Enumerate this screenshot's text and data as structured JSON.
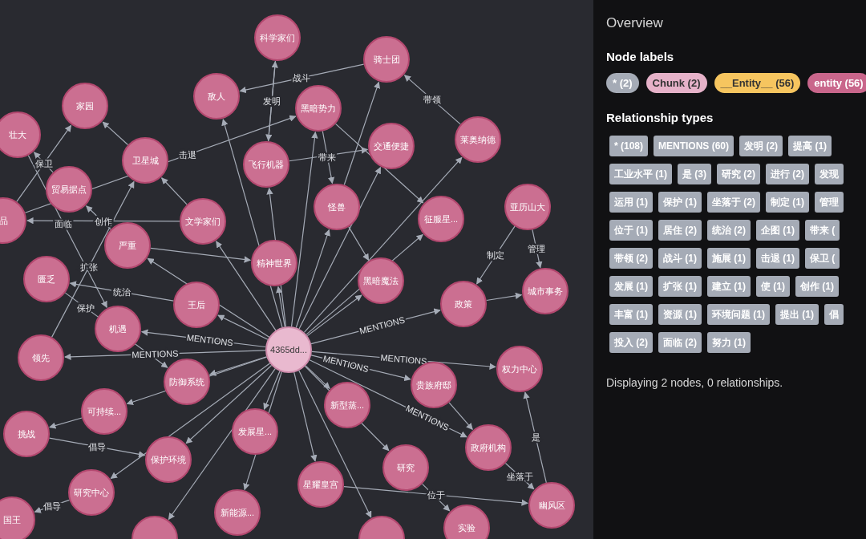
{
  "graph": {
    "nodes": [
      {
        "label": "科学家们",
        "kind": "entity"
      },
      {
        "label": "骑士团",
        "kind": "entity"
      },
      {
        "label": "敌人",
        "kind": "entity"
      },
      {
        "label": "黑暗势力",
        "kind": "entity"
      },
      {
        "label": "家园",
        "kind": "entity"
      },
      {
        "label": "壮大",
        "kind": "entity"
      },
      {
        "label": "卫星城",
        "kind": "entity"
      },
      {
        "label": "飞行机器",
        "kind": "entity"
      },
      {
        "label": "交通便捷",
        "kind": "entity"
      },
      {
        "label": "莱奥纳德",
        "kind": "entity"
      },
      {
        "label": "贸易据点",
        "kind": "entity"
      },
      {
        "label": "品",
        "kind": "entity"
      },
      {
        "label": "文学家们",
        "kind": "entity"
      },
      {
        "label": "怪兽",
        "kind": "entity"
      },
      {
        "label": "征服星...",
        "kind": "entity"
      },
      {
        "label": "亚历山大",
        "kind": "entity"
      },
      {
        "label": "严重",
        "kind": "entity"
      },
      {
        "label": "精神世界",
        "kind": "entity"
      },
      {
        "label": "匮乏",
        "kind": "entity"
      },
      {
        "label": "黑暗魔法",
        "kind": "entity"
      },
      {
        "label": "政策",
        "kind": "entity"
      },
      {
        "label": "城市事务",
        "kind": "entity"
      },
      {
        "label": "王后",
        "kind": "entity"
      },
      {
        "label": "机遇",
        "kind": "entity"
      },
      {
        "label": "4365dd...",
        "kind": "chunk"
      },
      {
        "label": "领先",
        "kind": "entity"
      },
      {
        "label": "防御系统",
        "kind": "entity"
      },
      {
        "label": "权力中心",
        "kind": "entity"
      },
      {
        "label": "贵族府邸",
        "kind": "entity"
      },
      {
        "label": "新型蒸...",
        "kind": "entity"
      },
      {
        "label": "可持续...",
        "kind": "entity"
      },
      {
        "label": "挑战",
        "kind": "entity"
      },
      {
        "label": "发展星...",
        "kind": "entity"
      },
      {
        "label": "政府机构",
        "kind": "entity"
      },
      {
        "label": "保护环境",
        "kind": "entity"
      },
      {
        "label": "研究",
        "kind": "entity"
      },
      {
        "label": "星耀皇宫",
        "kind": "entity"
      },
      {
        "label": "研究中心",
        "kind": "entity"
      },
      {
        "label": "国王",
        "kind": "entity"
      },
      {
        "label": "新能源...",
        "kind": "entity"
      },
      {
        "label": "实验",
        "kind": "entity"
      },
      {
        "label": "幽风区",
        "kind": "entity"
      },
      {
        "kind": "entity"
      },
      {
        "kind": "entity"
      }
    ],
    "relationships": [
      {
        "label": "战斗"
      },
      {
        "label": "发明"
      },
      {
        "label": "带领"
      },
      {
        "label": "保卫"
      },
      {
        "label": "击退"
      },
      {
        "label": "创作"
      },
      {
        "label": "扩张"
      },
      {
        "label": "统治"
      },
      {
        "label": "面临"
      },
      {
        "label": "保护"
      },
      {
        "label": "带来"
      },
      {
        "label": "制定"
      },
      {
        "label": "管理"
      },
      {
        "label": "是"
      },
      {
        "label": "坐落于"
      },
      {
        "label": "位于"
      },
      {
        "label": "倡导"
      },
      {
        "label": "倡导"
      },
      {
        "label": "MENTIONS"
      },
      {
        "label": "MENTIONS"
      },
      {
        "label": "MENTIONS"
      },
      {
        "label": "MENTIONS"
      },
      {
        "label": "MENTIONS"
      },
      {
        "label": "MENTIONS"
      }
    ]
  },
  "overview": {
    "title": "Overview",
    "node_labels_heading": "Node labels",
    "node_labels": [
      {
        "text": "* (2)",
        "color": "#a5abb6"
      },
      {
        "text": "Chunk (2)",
        "color": "#e6b2c9"
      },
      {
        "text": "__Entity__ (56)",
        "color": "#f6c55f"
      },
      {
        "text": "entity (56)",
        "color": "#c9668b"
      }
    ],
    "relationship_types_heading": "Relationship types",
    "relationship_type_rows": [
      [
        "* (108)",
        "MENTIONS (60)",
        "发明 (2)",
        "提高 (1)"
      ],
      [
        "工业水平 (1)",
        "是 (3)",
        "研究 (2)",
        "进行 (2)",
        "发现"
      ],
      [
        "运用 (1)",
        "保护 (1)",
        "坐落于 (2)",
        "制定 (1)",
        "管理"
      ],
      [
        "位于 (1)",
        "居住 (2)",
        "统治 (2)",
        "企图 (1)",
        "带来 ("
      ],
      [
        "带领 (2)",
        "战斗 (1)",
        "施展 (1)",
        "击退 (1)",
        "保卫 ("
      ],
      [
        "发展 (1)",
        "扩张 (1)",
        "建立 (1)",
        "使 (1)",
        "创作 (1)"
      ],
      [
        "丰富 (1)",
        "资源 (1)",
        "环境问题 (1)",
        "提出 (1)",
        "倡"
      ],
      [
        "投入 (2)",
        "面临 (2)",
        "努力 (1)"
      ]
    ],
    "status": "Displaying 2 nodes, 0 relationships."
  }
}
